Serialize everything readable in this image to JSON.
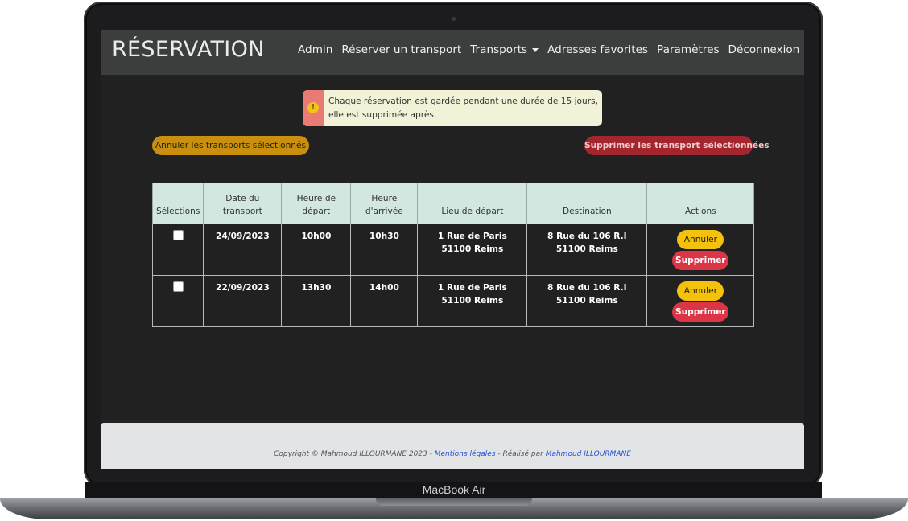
{
  "device": {
    "brand": "MacBook Air"
  },
  "navbar": {
    "logo": "RÉSERVATION",
    "links": [
      "Admin",
      "Réserver un transport",
      "Transports",
      "Adresses favorites",
      "Paramètres",
      "Déconnexion"
    ]
  },
  "alert": {
    "text": "Chaque réservation est gardée pendant une durée de 15 jours, elle est supprimée après."
  },
  "actions": {
    "cancel_selected": "Annuler les transports sélectionnés",
    "delete_selected": "Supprimer les transport sélectionnées"
  },
  "table": {
    "headers": [
      "Sélections",
      "Date du transport",
      "Heure de départ",
      "Heure d'arrivée",
      "Lieu de départ",
      "Destination",
      "Actions"
    ],
    "rows": [
      {
        "date": "24/09/2023",
        "depart_time": "10h00",
        "arrival_time": "10h30",
        "from": "1 Rue de Paris 51100 Reims",
        "to": "8 Rue du 106 R.I 51100 Reims",
        "cancel": "Annuler",
        "delete": "Supprimer"
      },
      {
        "date": "22/09/2023",
        "depart_time": "13h30",
        "arrival_time": "14h00",
        "from": "1 Rue de Paris 51100 Reims",
        "to": "8 Rue du 106 R.I 51100 Reims",
        "cancel": "Annuler",
        "delete": "Supprimer"
      }
    ]
  },
  "footer": {
    "prefix": "Copyright © Mahmoud ILLOURMANE 2023 - ",
    "legal_link": "Mentions légales",
    "middle": " - Réalisé par ",
    "author_link": "Mahmoud ILLOURMANE"
  },
  "colors": {
    "navbar_bg": "#3b3e3c",
    "page_bg": "#212121",
    "warning": "#f4c20d",
    "danger": "#dc3545",
    "table_header": "#d2e7e0"
  }
}
